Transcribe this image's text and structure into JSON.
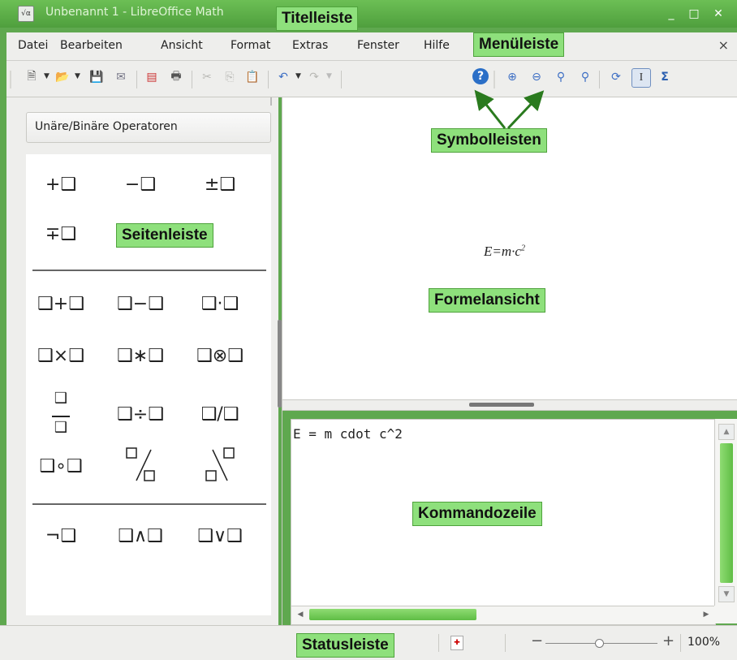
{
  "window": {
    "title": "Unbenannt 1 - LibreOffice Math",
    "controls": {
      "minimize": "_",
      "maximize": "□",
      "close": "✕"
    }
  },
  "menubar": {
    "items": [
      "Datei",
      "Bearbeiten",
      "Ansicht",
      "Format",
      "Extras",
      "Fenster",
      "Hilfe"
    ],
    "close": "×"
  },
  "toolbar": {
    "icons": [
      "new-document-icon",
      "open-icon",
      "save-icon",
      "email-icon",
      "export-pdf-icon",
      "print-icon",
      "cut-icon",
      "copy-icon",
      "paste-icon",
      "undo-icon",
      "redo-icon",
      "help-icon",
      "zoom-in-icon",
      "zoom-out-icon",
      "zoom-100-icon",
      "show-all-icon",
      "update-icon",
      "formula-cursor-icon",
      "symbols-icon"
    ]
  },
  "sidebar": {
    "category": "Unäre/Binäre Operatoren",
    "group1": [
      "+❑",
      "−❑",
      "±❑",
      "∓❑"
    ],
    "group2": [
      "❑+❑",
      "❑−❑",
      "❑·❑",
      "❑×❑",
      "❑∗❑",
      "❑⊗❑",
      "❑÷❑",
      "❑/❑",
      "❑∘❑"
    ],
    "group3": [
      "¬❑",
      "❑∧❑",
      "❑∨❑"
    ]
  },
  "formula": {
    "text": "E=m·c",
    "exponent": "2"
  },
  "command": {
    "text": "E = m cdot c^2"
  },
  "statusbar": {
    "zoom": "100%",
    "zoom_level": 0.45
  },
  "annotations": {
    "title_bar": "Titelleiste",
    "menu_bar": "Menüleiste",
    "toolbars": "Symbolleisten",
    "sidebar": "Seitenleiste",
    "formula_view": "Formelansicht",
    "command_line": "Kommandozeile",
    "status_bar": "Statusleiste"
  },
  "colors": {
    "accent": "#8ee07c",
    "titlebar": "#5fa84f",
    "background": "#eeeeec"
  }
}
